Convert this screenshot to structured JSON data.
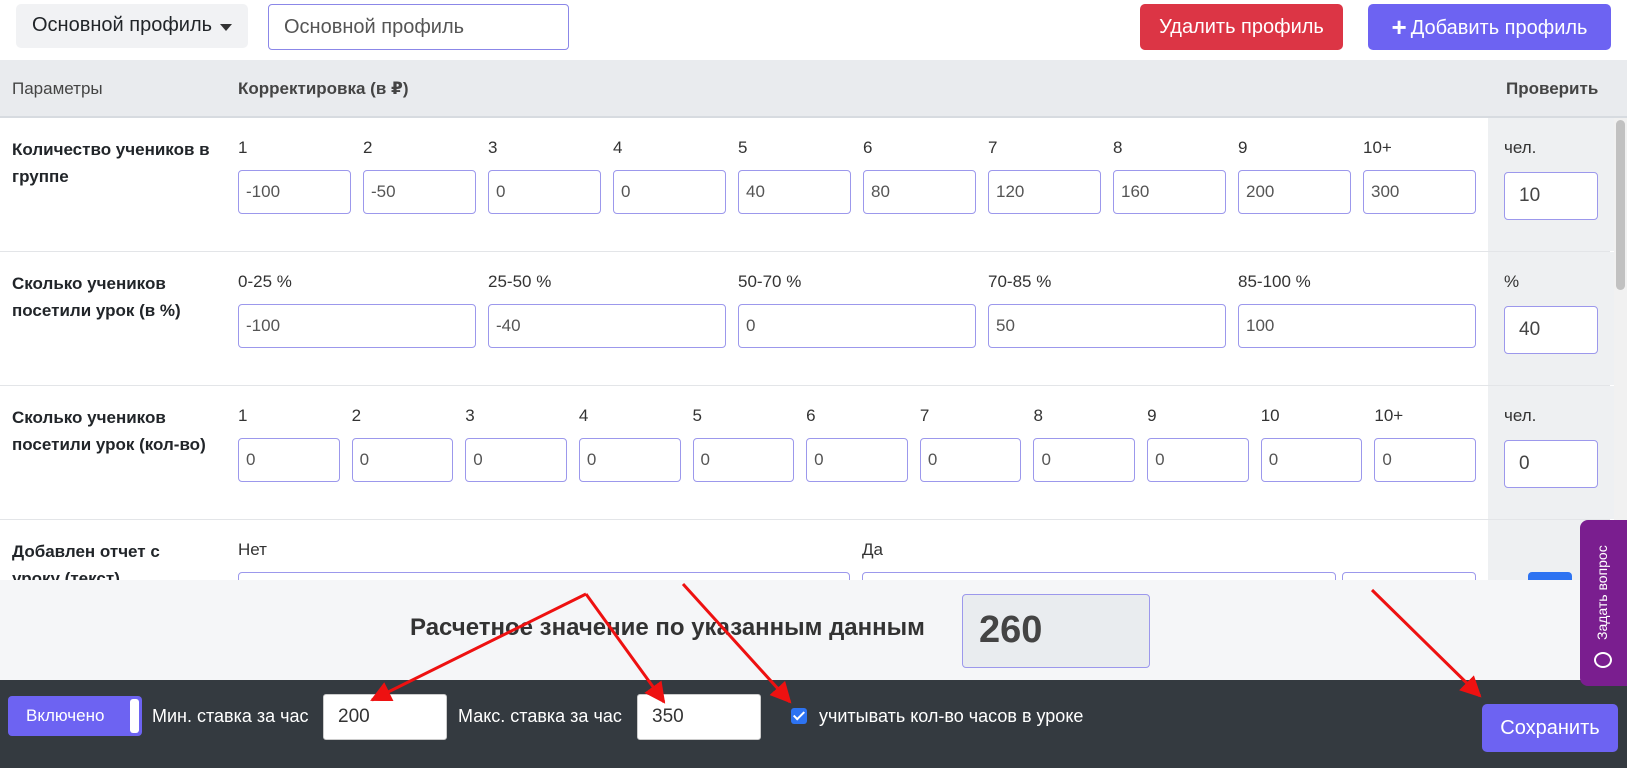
{
  "profile": {
    "dropdown_label": "Основной профиль",
    "name_value": "Основной профиль",
    "delete_label": "Удалить профиль",
    "add_label": "Добавить профиль"
  },
  "table": {
    "headers": {
      "params": "Параметры",
      "correction": "Корректировка (в ₽)",
      "check": "Проверить"
    },
    "rows": [
      {
        "label": "Количество учеников в группе",
        "cells": [
          {
            "label": "1",
            "value": "-100"
          },
          {
            "label": "2",
            "value": "-50"
          },
          {
            "label": "3",
            "value": "0"
          },
          {
            "label": "4",
            "value": "0"
          },
          {
            "label": "5",
            "value": "40"
          },
          {
            "label": "6",
            "value": "80"
          },
          {
            "label": "7",
            "value": "120"
          },
          {
            "label": "8",
            "value": "160"
          },
          {
            "label": "9",
            "value": "200"
          },
          {
            "label": "10+",
            "value": "300"
          }
        ],
        "check_label": "чел.",
        "check_value": "10"
      },
      {
        "label": "Сколько учеников посетили урок (в %)",
        "cells": [
          {
            "label": "0-25 %",
            "value": "-100"
          },
          {
            "label": "25-50 %",
            "value": "-40"
          },
          {
            "label": "50-70 %",
            "value": "0"
          },
          {
            "label": "70-85 %",
            "value": "50"
          },
          {
            "label": "85-100 %",
            "value": "100"
          }
        ],
        "check_label": "%",
        "check_value": "40"
      },
      {
        "label": "Сколько учеников посетили урок (кол-во)",
        "cells": [
          {
            "label": "1",
            "value": "0"
          },
          {
            "label": "2",
            "value": "0"
          },
          {
            "label": "3",
            "value": "0"
          },
          {
            "label": "4",
            "value": "0"
          },
          {
            "label": "5",
            "value": "0"
          },
          {
            "label": "6",
            "value": "0"
          },
          {
            "label": "7",
            "value": "0"
          },
          {
            "label": "8",
            "value": "0"
          },
          {
            "label": "9",
            "value": "0"
          },
          {
            "label": "10",
            "value": "0"
          },
          {
            "label": "10+",
            "value": "0"
          }
        ],
        "check_label": "чел.",
        "check_value": "0"
      },
      {
        "label": "Добавлен отчет с уроку (текст)",
        "cells": [
          {
            "label": "Нет"
          },
          {
            "label": "Да"
          }
        ]
      }
    ]
  },
  "calc": {
    "label": "Расчетное значение по указанным данным",
    "value": "260"
  },
  "footer": {
    "toggle_label": "Включено",
    "min_label": "Мин. ставка за час",
    "min_value": "200",
    "max_label": "Макс. ставка за час",
    "max_value": "350",
    "hours_label": "учитывать кол-во часов в уроке",
    "save_label": "Сохранить"
  },
  "ask_label": "Задать вопрос",
  "colors": {
    "accent": "#6d63f2",
    "danger": "#dc3545",
    "footer_bg": "#343a40",
    "arrow": "#ee1111",
    "ask_bg": "#7a1e8f"
  }
}
